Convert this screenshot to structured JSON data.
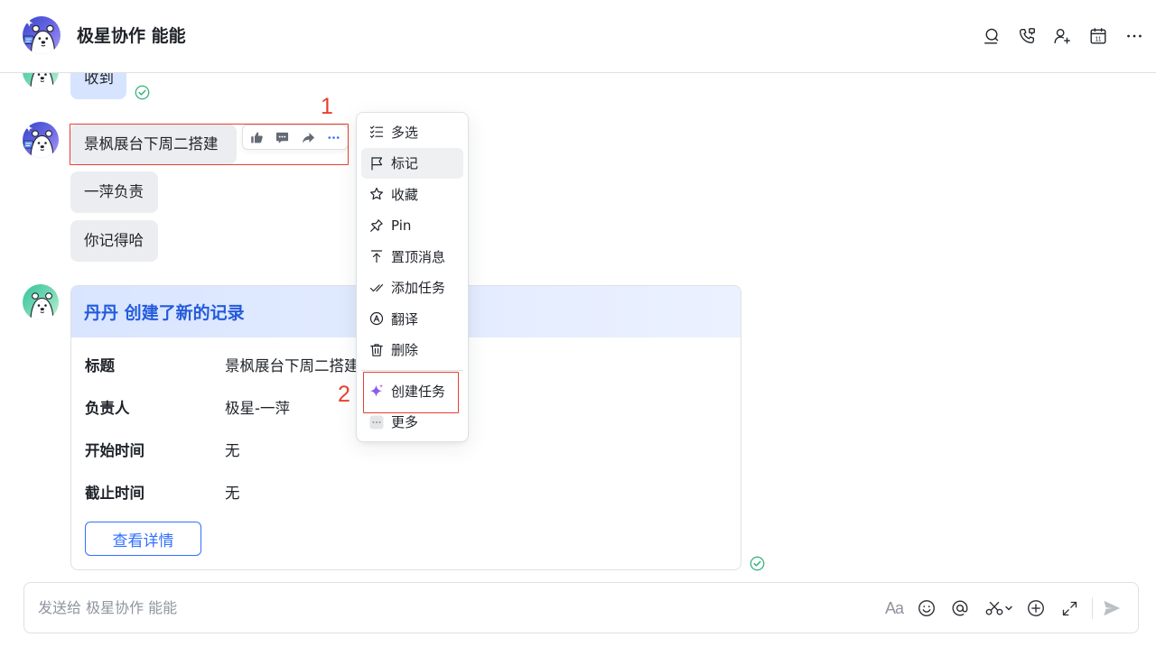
{
  "header": {
    "title": "极星协作 能能",
    "calendar_day": "11",
    "avatar_icon": "polar-bear-avatar-icon",
    "action_icons": [
      "search-member-icon",
      "call-icon",
      "add-member-icon",
      "calendar-icon",
      "more-icon"
    ]
  },
  "messages": [
    {
      "text": "收到",
      "status_icon": "read-check-icon"
    },
    {
      "text": "景枫展台下周二搭建"
    },
    {
      "text": "一萍负责"
    },
    {
      "text": "你记得哈"
    }
  ],
  "hover_toolbar": {
    "icons": [
      "thumbs-up-icon",
      "reply-icon",
      "forward-icon",
      "more-icon"
    ]
  },
  "record_card": {
    "header": "丹丹 创建了新的记录",
    "fields": [
      {
        "label": "标题",
        "value": "景枫展台下周二搭建"
      },
      {
        "label": "负责人",
        "value": "极星-一萍"
      },
      {
        "label": "开始时间",
        "value": "无"
      },
      {
        "label": "截止时间",
        "value": "无"
      }
    ],
    "button_label": "查看详情",
    "status_icon": "read-check-icon"
  },
  "context_menu": {
    "items": [
      {
        "label": "多选",
        "icon": "multi-select-icon"
      },
      {
        "label": "标记",
        "icon": "flag-icon",
        "hovered": true
      },
      {
        "label": "收藏",
        "icon": "star-icon"
      },
      {
        "label": "Pin",
        "icon": "pin-icon"
      },
      {
        "label": "置顶消息",
        "icon": "pin-to-top-icon"
      },
      {
        "label": "添加任务",
        "icon": "add-task-icon"
      },
      {
        "label": "翻译",
        "icon": "translate-icon"
      },
      {
        "label": "删除",
        "icon": "delete-icon"
      },
      {
        "label": "创建任务",
        "icon": "ai-sparkle-icon"
      },
      {
        "label": "更多",
        "icon": "more-icon"
      }
    ]
  },
  "annotations": {
    "step_1": "1",
    "step_2": "2"
  },
  "composer": {
    "placeholder": "发送给 极星协作 能能",
    "format_label": "Aa",
    "icons": [
      "text-format-icon",
      "emoji-icon",
      "mention-icon",
      "screenshot-scissors-icon",
      "add-icon",
      "expand-icon",
      "send-icon"
    ]
  },
  "colors": {
    "accent": "#3370ff",
    "card_title": "#245bdb",
    "annotation_red": "#e5402f",
    "read_green": "#34b27b",
    "self_bubble": "#d6e4ff",
    "other_bubble": "#ebedf0",
    "card_header_bg": "#e1eaff"
  }
}
